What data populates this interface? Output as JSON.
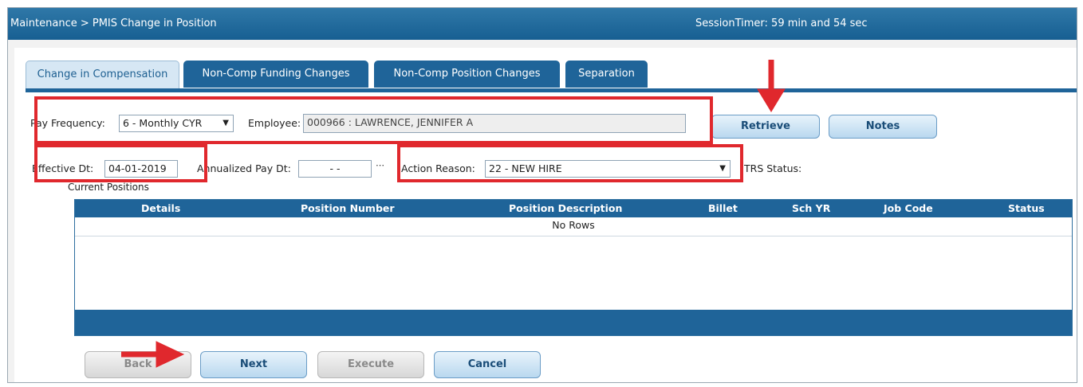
{
  "header": {
    "breadcrumb": "Maintenance > PMIS Change in Position",
    "session_timer": "SessionTimer: 59 min and 54 sec"
  },
  "tabs": [
    {
      "label": "Change in Compensation",
      "active": true
    },
    {
      "label": "Non-Comp Funding Changes",
      "active": false
    },
    {
      "label": "Non-Comp Position Changes",
      "active": false
    },
    {
      "label": "Separation",
      "active": false
    }
  ],
  "form": {
    "pay_frequency_label": "Pay Frequency:",
    "pay_frequency_value": "6 - Monthly CYR",
    "employee_label": "Employee:",
    "employee_value": "000966 : LAWRENCE, JENNIFER A",
    "effective_dt_label": "Effective Dt:",
    "effective_dt_value": "04-01-2019",
    "annualized_pay_dt_label": "Annualized Pay Dt:",
    "annualized_pay_dt_value": "- -",
    "action_reason_label": "Action Reason:",
    "action_reason_value": "22 - NEW HIRE",
    "trs_status_label": "TRS Status:"
  },
  "buttons": {
    "retrieve": "Retrieve",
    "notes": "Notes",
    "back": "Back",
    "next": "Next",
    "execute": "Execute",
    "cancel": "Cancel"
  },
  "positions": {
    "title": "Current Positions",
    "columns": [
      "Details",
      "Position Number",
      "Position Description",
      "Billet",
      "Sch YR",
      "Job Code",
      "Status"
    ],
    "empty_text": "No Rows"
  },
  "annotation_color": "#e0282d"
}
